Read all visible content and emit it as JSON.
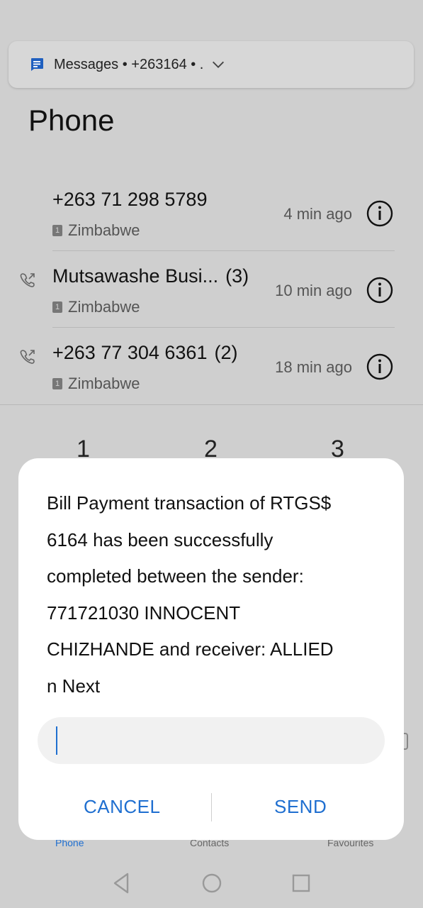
{
  "notification": {
    "label": "Messages • +263164 • .",
    "icon": "messages-icon"
  },
  "page_title": "Phone",
  "calls": [
    {
      "name": "+263 71 298 5789",
      "count": "",
      "location": "Zimbabwe",
      "time": "4 min ago",
      "type_icon": ""
    },
    {
      "name": "Mutsawashe Busi...",
      "count": "(3)",
      "location": "Zimbabwe",
      "time": "10 min ago",
      "type_icon": "outgoing-call-icon"
    },
    {
      "name": "+263 77 304 6361",
      "count": "(2)",
      "location": "Zimbabwe",
      "time": "18 min ago",
      "type_icon": "outgoing-call-icon"
    }
  ],
  "sim_label": "1",
  "dialpad_visible": [
    "1",
    "2",
    "3"
  ],
  "bottom_tabs": [
    "Phone",
    "Contacts",
    "Favourites"
  ],
  "dialog": {
    "message_lines": [
      "Bill Payment transaction of RTGS$",
      "6164 has been successfully",
      "completed between the sender:",
      "771721030 INNOCENT",
      "CHIZHANDE and receiver: ALLIED",
      "n Next"
    ],
    "input_value": "",
    "cancel_label": "CANCEL",
    "send_label": "SEND"
  },
  "colors": {
    "accent": "#1f6fd0",
    "scrim": "#cfcfcf",
    "dialog_bg": "#ffffff"
  }
}
